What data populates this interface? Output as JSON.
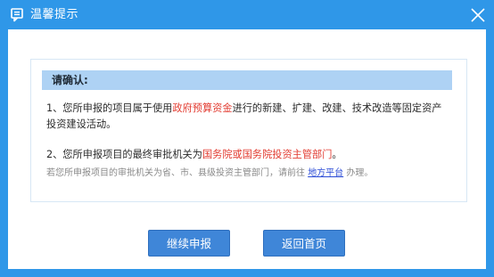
{
  "dialog": {
    "title": "温馨提示",
    "icon": "message-icon",
    "close_icon": "close-icon",
    "accent_color": "#2f97e8"
  },
  "notice": {
    "header": "请确认:",
    "item1_prefix": "1、您所申报的项目属于使用",
    "item1_highlight": "政府预算资金",
    "item1_suffix": "进行的新建、扩建、改建、技术改造等固定资产",
    "item1_line2": "投资建设活动。",
    "item2_prefix": "2、您所申报项目的最终审批机关为",
    "item2_highlight": "国务院或国务院投资主管部门",
    "item2_suffix": "。",
    "note_prefix": "若您所申报项目的审批机关为省、市、县级投资主管部门，请前往",
    "note_link": "地方平台",
    "note_suffix": "办理。",
    "highlight_color": "#e23a2f",
    "link_color": "#2a4bd6"
  },
  "buttons": {
    "continue_label": "继续申报",
    "home_label": "返回首页"
  }
}
